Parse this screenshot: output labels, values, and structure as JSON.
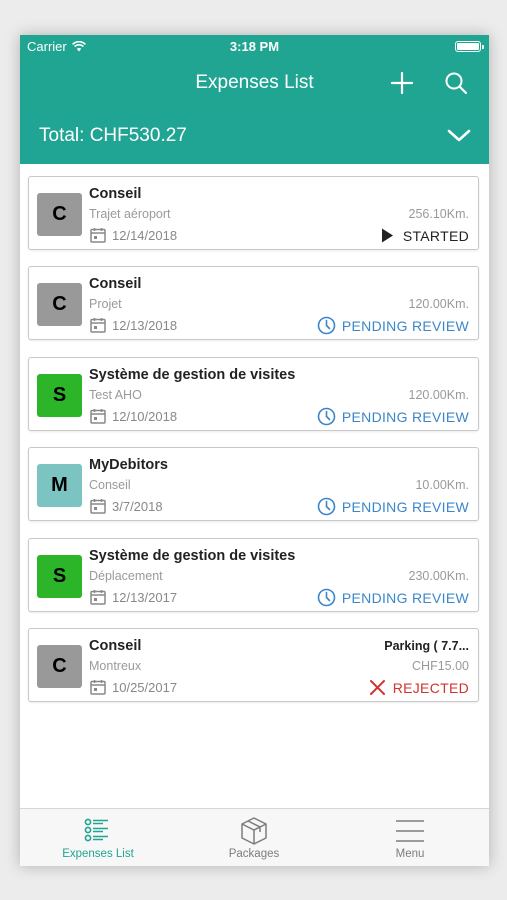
{
  "status_bar": {
    "carrier": "Carrier",
    "time": "3:18 PM"
  },
  "header": {
    "title": "Expenses List",
    "add_icon": "plus-icon",
    "search_icon": "search-icon"
  },
  "total": {
    "label": "Total: CHF530.27",
    "toggle_icon": "chevron-down-icon"
  },
  "expenses": [
    {
      "initial": "C",
      "avatar_color": "#999999",
      "title": "Conseil",
      "subtitle": "Trajet aéroport",
      "date": "12/14/2018",
      "amount_label": "",
      "amount": "256.10Km.",
      "status": "STARTED",
      "status_icon": "play-icon",
      "status_color": "#222222"
    },
    {
      "initial": "C",
      "avatar_color": "#999999",
      "title": "Conseil",
      "subtitle": "Projet",
      "date": "12/13/2018",
      "amount_label": "",
      "amount": "120.00Km.",
      "status": "PENDING REVIEW",
      "status_icon": "clock-icon",
      "status_color": "#3a86c8"
    },
    {
      "initial": "S",
      "avatar_color": "#2db52a",
      "title": "Système de gestion de visites",
      "subtitle": "Test AHO",
      "date": "12/10/2018",
      "amount_label": "",
      "amount": "120.00Km.",
      "status": "PENDING REVIEW",
      "status_icon": "clock-icon",
      "status_color": "#3a86c8"
    },
    {
      "initial": "M",
      "avatar_color": "#7cc4c2",
      "title": "MyDebitors",
      "subtitle": "Conseil",
      "date": "3/7/2018",
      "amount_label": "",
      "amount": "10.00Km.",
      "status": "PENDING REVIEW",
      "status_icon": "clock-icon",
      "status_color": "#3a86c8"
    },
    {
      "initial": "S",
      "avatar_color": "#2db52a",
      "title": "Système de gestion de visites",
      "subtitle": "Déplacement",
      "date": "12/13/2017",
      "amount_label": "",
      "amount": "230.00Km.",
      "status": "PENDING REVIEW",
      "status_icon": "clock-icon",
      "status_color": "#3a86c8"
    },
    {
      "initial": "C",
      "avatar_color": "#999999",
      "title": "Conseil",
      "subtitle": "Montreux",
      "date": "10/25/2017",
      "amount_label": "Parking ( 7.7...",
      "amount": "CHF15.00",
      "status": "REJECTED",
      "status_icon": "x-icon",
      "status_color": "#d0342c"
    }
  ],
  "tabs": [
    {
      "label": "Expenses List",
      "icon": "list-icon",
      "active": true
    },
    {
      "label": "Packages",
      "icon": "package-icon",
      "active": false
    },
    {
      "label": "Menu",
      "icon": "menu-icon",
      "active": false
    }
  ],
  "colors": {
    "primary": "#1fa592",
    "pending": "#3a86c8",
    "rejected": "#d0342c"
  }
}
